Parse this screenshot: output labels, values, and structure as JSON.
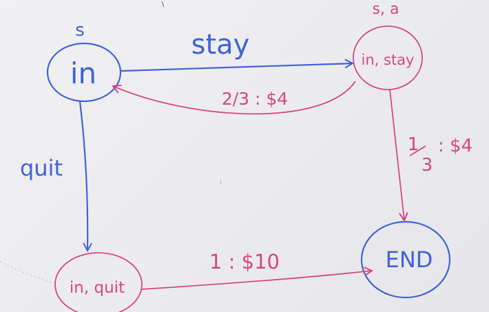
{
  "colors": {
    "blue": "#3f62d8",
    "pink": "#d9457d"
  },
  "headers": {
    "state": "s",
    "q_state": "s, a"
  },
  "nodes": {
    "in": "in",
    "in_stay": "in, stay",
    "in_quit": "in, quit",
    "end": "END"
  },
  "edges": {
    "stay": "stay",
    "quit": "quit",
    "back_to_in": "2/3 : $4",
    "stay_to_end_num": "1",
    "stay_to_end_den": "3",
    "stay_to_end_reward": ": $4",
    "quit_to_end": "1 : $10"
  }
}
